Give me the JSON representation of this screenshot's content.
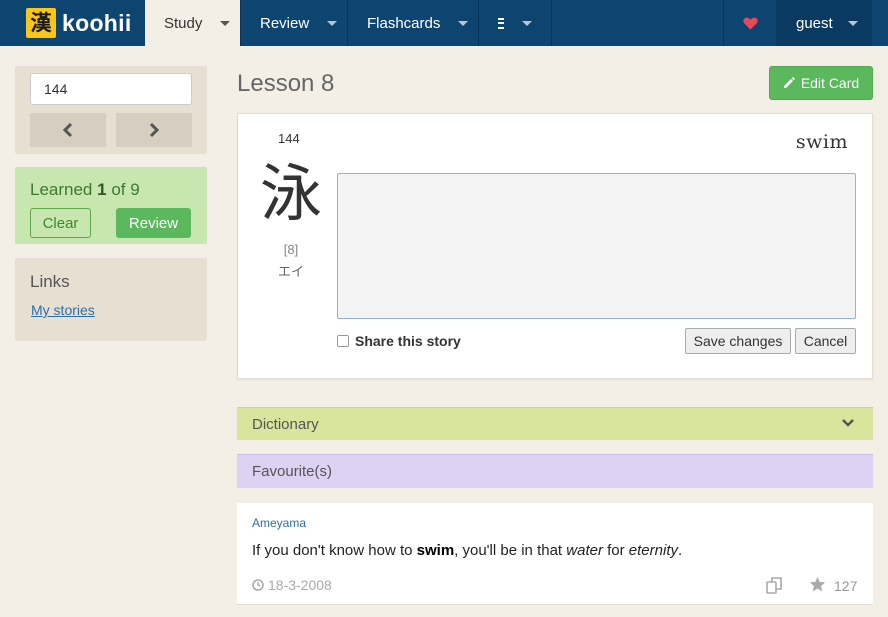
{
  "navbar": {
    "logo_kanji": "漢",
    "logo_text": "koohii",
    "items": [
      {
        "label": "Study"
      },
      {
        "label": "Review"
      },
      {
        "label": "Flashcards"
      }
    ],
    "user_label": "guest",
    "heart_color": "#e8495a"
  },
  "sidebar": {
    "frame_input_value": "144",
    "learned": {
      "prefix": "Learned ",
      "count": "1",
      "mid": " of ",
      "total": "9"
    },
    "clear_label": "Clear",
    "review_label": "Review",
    "links_title": "Links",
    "links": [
      {
        "label": "My stories"
      }
    ]
  },
  "main": {
    "lesson_title": "Lesson 8",
    "edit_card_label": "Edit Card",
    "card": {
      "frame_number": "144",
      "keyword": "swim",
      "kanji": "泳",
      "stroke_count": "[8]",
      "reading": "エイ",
      "story_value": "",
      "share_label": "Share this story",
      "save_label": "Save changes",
      "cancel_label": "Cancel"
    },
    "dictionary_label": "Dictionary",
    "favourites_label": "Favourite(s)",
    "story": {
      "author": "Ameyama",
      "text_1": "If you don't know how to ",
      "text_bold": "swim",
      "text_2": ", you'll be in that ",
      "text_em1": "water",
      "text_3": " for ",
      "text_em2": "eternity",
      "text_4": ".",
      "date": "18-3-2008",
      "stars": "127"
    }
  },
  "colors": {
    "navbar": "#0e4470",
    "accent_green": "#5cb85c",
    "dictionary_bar": "#d9e59c",
    "favourites_bar": "#ddd2f3"
  }
}
